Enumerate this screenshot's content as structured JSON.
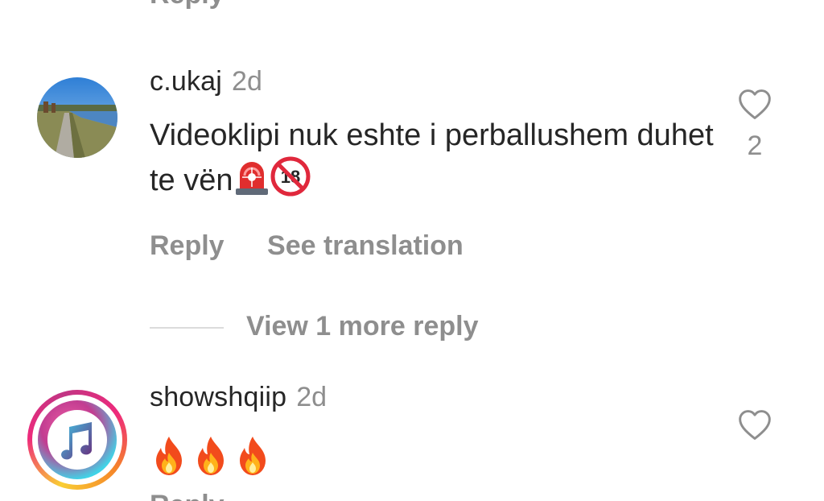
{
  "top_clipped_action": "Reply",
  "comments": [
    {
      "username": "c.ukaj",
      "time": "2d",
      "text": "Videoklipi nuk eshte i perballushem duhet te vën",
      "emojis": [
        "rotating-light-emoji",
        "no-under-18-emoji"
      ],
      "likes": "2",
      "actions": [
        "Reply",
        "See translation"
      ],
      "view_replies": "View 1 more reply"
    },
    {
      "username": "showshqiip",
      "time": "2d",
      "emojis": [
        "fire-emoji",
        "fire-emoji",
        "fire-emoji"
      ],
      "action": "Reply"
    }
  ],
  "colors": {
    "text": "#262626",
    "secondary": "#8e8e8e",
    "divider": "#dbdbdb"
  }
}
